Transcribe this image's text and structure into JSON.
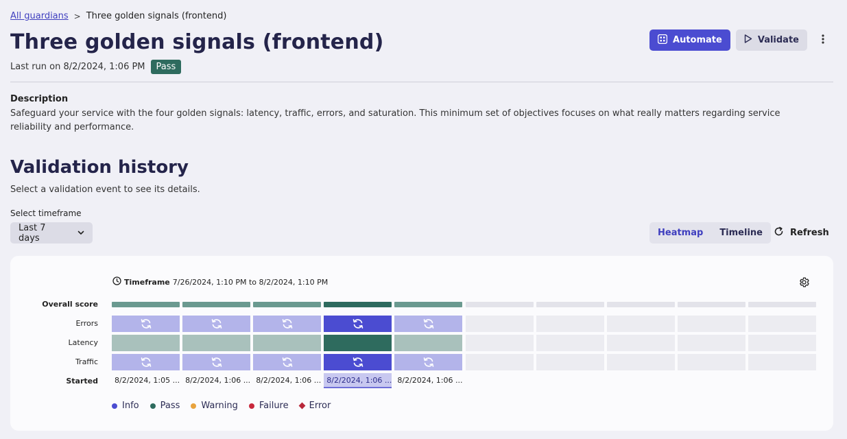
{
  "breadcrumb": {
    "parent": "All guardians",
    "current": "Three golden signals (frontend)"
  },
  "header": {
    "title": "Three golden signals (frontend)",
    "last_run": "Last run on 8/2/2024, 1:06 PM",
    "status": "Pass",
    "automate_label": "Automate",
    "validate_label": "Validate"
  },
  "description": {
    "title": "Description",
    "text": "Safeguard your service with the four golden signals: latency, traffic, errors, and saturation. This minimum set of objectives focuses on what really matters regarding service reliability and performance."
  },
  "history": {
    "title": "Validation history",
    "subtitle": "Select a validation event to see its details.",
    "timeframe_label": "Select timeframe",
    "timeframe_value": "Last 7 days",
    "view_tabs": [
      "Heatmap",
      "Timeline"
    ],
    "refresh_label": "Refresh"
  },
  "heatmap": {
    "timeframe_prefix": "Timeframe",
    "timeframe_range": "7/26/2024, 1:10 PM to 8/2/2024, 1:10 PM",
    "row_labels": [
      "Overall score",
      "Errors",
      "Latency",
      "Traffic",
      "Started"
    ],
    "total_slots": 10,
    "selected_index": 3,
    "events": [
      {
        "started": "8/2/2024, 1:05 ...",
        "overall": "pass",
        "errors": "info",
        "latency": "pass",
        "traffic": "info"
      },
      {
        "started": "8/2/2024, 1:06 ...",
        "overall": "pass",
        "errors": "info",
        "latency": "pass",
        "traffic": "info"
      },
      {
        "started": "8/2/2024, 1:06 ...",
        "overall": "pass",
        "errors": "info",
        "latency": "pass",
        "traffic": "info"
      },
      {
        "started": "8/2/2024, 1:06 ...",
        "overall": "pass",
        "errors": "info",
        "latency": "pass",
        "traffic": "info"
      },
      {
        "started": "8/2/2024, 1:06 ...",
        "overall": "pass",
        "errors": "info",
        "latency": "pass",
        "traffic": "info"
      }
    ],
    "legend": [
      {
        "label": "Info",
        "color": "#4b4cd1",
        "shape": "dot"
      },
      {
        "label": "Pass",
        "color": "#2e6b5e",
        "shape": "dot"
      },
      {
        "label": "Warning",
        "color": "#e8a33d",
        "shape": "dot"
      },
      {
        "label": "Failure",
        "color": "#c8283c",
        "shape": "dot"
      },
      {
        "label": "Error",
        "color": "#b8283a",
        "shape": "diamond"
      }
    ]
  },
  "colors": {
    "accent": "#4b4cd1",
    "pass": "#2e6b5e",
    "overall_pass": "#6b9a90",
    "overall_pass_selected": "#2e6b5e",
    "info": "#b3b4ea",
    "info_selected": "#4b4cd1",
    "pass_cell": "#a9c1bc",
    "pass_cell_selected": "#2e6b5e",
    "empty": "#ececf1",
    "empty_bar": "#e3e3ea"
  }
}
